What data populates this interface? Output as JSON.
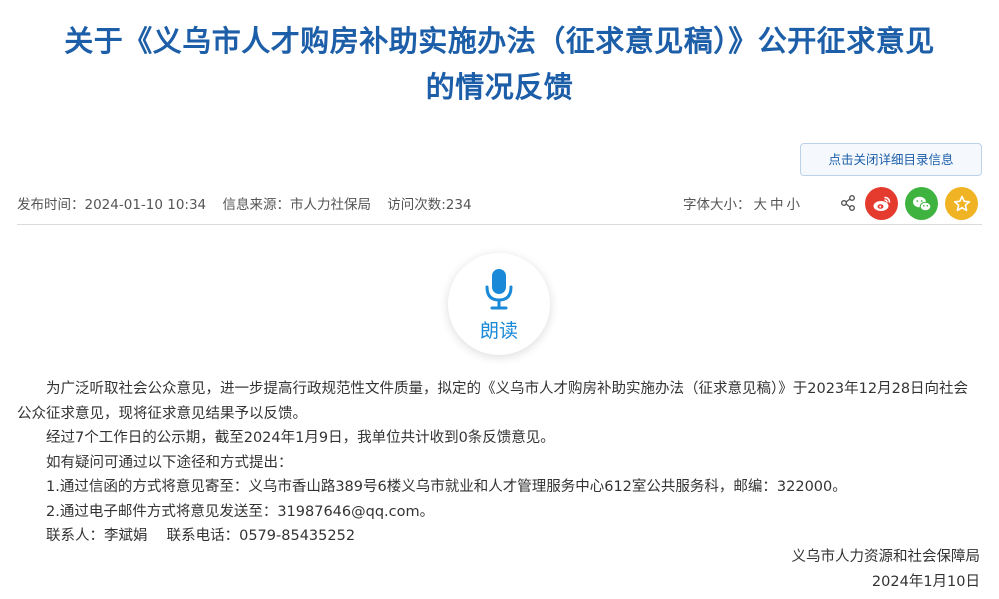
{
  "article": {
    "title_line1": "关于《义乌市人才购房补助实施办法（征求意见稿）》公开征求意见",
    "title_line2": "的情况反馈"
  },
  "catalog_button": "点击关闭详细目录信息",
  "meta": {
    "publish_time": "发布时间：2024-01-10 10:34",
    "source": "信息来源：市人力社保局",
    "visits": "访问次数:234",
    "font_size_label": "字体大小：",
    "font_large": "大",
    "font_medium": "中",
    "font_small": "小"
  },
  "icons": {
    "share": "share-icon",
    "weibo": "weibo-icon",
    "wechat": "wechat-icon",
    "favorite": "star-icon",
    "microphone": "microphone-icon"
  },
  "colors": {
    "title": "#1d5ea8",
    "weibo": "#e53a2e",
    "wechat": "#3fb33f",
    "favorite": "#f0b323",
    "read_accent": "#1989d8"
  },
  "read_aloud": {
    "label": "朗读"
  },
  "content": {
    "paragraphs": [
      "为广泛听取社会公众意见，进一步提高行政规范性文件质量，拟定的《义乌市人才购房补助实施办法（征求意见稿）》于2023年12月28日向社会公众征求意见，现将征求意见结果予以反馈。",
      "经过7个工作日的公示期，截至2024年1月9日，我单位共计收到0条反馈意见。",
      "如有疑问可通过以下途径和方式提出：",
      "1.通过信函的方式将意见寄至：义乌市香山路389号6楼义乌市就业和人才管理服务中心612室公共服务科，邮编：322000。",
      "2.通过电子邮件方式将意见发送至：31987646@qq.com。",
      "联系人：李斌娟　 联系电话：0579-85435252"
    ],
    "signature_org": "义乌市人力资源和社会保障局",
    "signature_date": "2024年1月10日"
  }
}
